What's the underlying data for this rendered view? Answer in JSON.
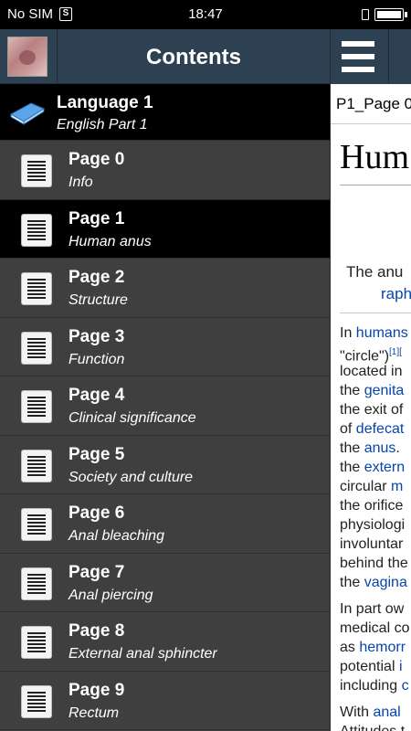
{
  "status_bar": {
    "carrier": "No SIM",
    "sim_icon": "S",
    "time": "18:47"
  },
  "drawer": {
    "title": "Contents",
    "section": {
      "title": "Language 1",
      "subtitle": "English Part 1"
    },
    "items": [
      {
        "title": "Page 0",
        "subtitle": "Info",
        "selected": false
      },
      {
        "title": "Page 1",
        "subtitle": "Human anus",
        "selected": true
      },
      {
        "title": "Page 2",
        "subtitle": "Structure",
        "selected": false
      },
      {
        "title": "Page 3",
        "subtitle": "Function",
        "selected": false
      },
      {
        "title": "Page 4",
        "subtitle": "Clinical significance",
        "selected": false
      },
      {
        "title": "Page 5",
        "subtitle": "Society and culture",
        "selected": false
      },
      {
        "title": "Page 6",
        "subtitle": "Anal bleaching",
        "selected": false
      },
      {
        "title": "Page 7",
        "subtitle": "Anal piercing",
        "selected": false
      },
      {
        "title": "Page 8",
        "subtitle": "External anal sphincter",
        "selected": false
      },
      {
        "title": "Page 9",
        "subtitle": "Rectum",
        "selected": false
      }
    ]
  },
  "main": {
    "page_label": "P1_Page 0",
    "article_title": "Hum",
    "caption_1": "The anu",
    "caption_2": "raph",
    "lines": [
      {
        "parts": [
          {
            "t": "In "
          },
          {
            "t": "humans",
            "link": true
          }
        ]
      },
      {
        "parts": [
          {
            "t": "\"circle\")"
          },
          {
            "t": "[1][",
            "sup": true
          }
        ]
      },
      {
        "parts": [
          {
            "t": "located in"
          }
        ]
      },
      {
        "parts": [
          {
            "t": "the "
          },
          {
            "t": "genita",
            "link": true
          }
        ]
      },
      {
        "parts": [
          {
            "t": "the exit of"
          }
        ]
      },
      {
        "parts": [
          {
            "t": "of "
          },
          {
            "t": "defecat",
            "link": true
          }
        ]
      },
      {
        "parts": [
          {
            "t": "the "
          },
          {
            "t": "anus",
            "link": true
          },
          {
            "t": ". "
          }
        ]
      },
      {
        "parts": [
          {
            "t": "the "
          },
          {
            "t": "extern",
            "link": true
          }
        ]
      },
      {
        "parts": [
          {
            "t": "circular "
          },
          {
            "t": "m",
            "link": true
          }
        ]
      },
      {
        "parts": [
          {
            "t": "the orifice"
          }
        ]
      },
      {
        "parts": [
          {
            "t": "physiologi"
          }
        ]
      },
      {
        "parts": [
          {
            "t": "involuntar"
          }
        ]
      },
      {
        "parts": [
          {
            "t": "behind the"
          }
        ]
      },
      {
        "parts": [
          {
            "t": "the "
          },
          {
            "t": "vagina",
            "link": true
          }
        ]
      },
      {
        "gap": true,
        "parts": [
          {
            "t": "In part ow"
          }
        ]
      },
      {
        "parts": [
          {
            "t": "medical co"
          }
        ]
      },
      {
        "parts": [
          {
            "t": "as "
          },
          {
            "t": "hemorr",
            "link": true
          }
        ]
      },
      {
        "parts": [
          {
            "t": "potential "
          },
          {
            "t": "i",
            "link": true
          }
        ]
      },
      {
        "parts": [
          {
            "t": "including "
          },
          {
            "t": "c",
            "link": true
          }
        ]
      },
      {
        "gap": true,
        "parts": [
          {
            "t": "With "
          },
          {
            "t": "anal",
            "link": true
          }
        ]
      },
      {
        "parts": [
          {
            "t": "Attitudes t"
          }
        ]
      }
    ]
  },
  "colors": {
    "header_bg": "#2d4152",
    "drawer_bg": "#3f3f3f",
    "selected_bg": "#000000",
    "link": "#0645ad"
  }
}
